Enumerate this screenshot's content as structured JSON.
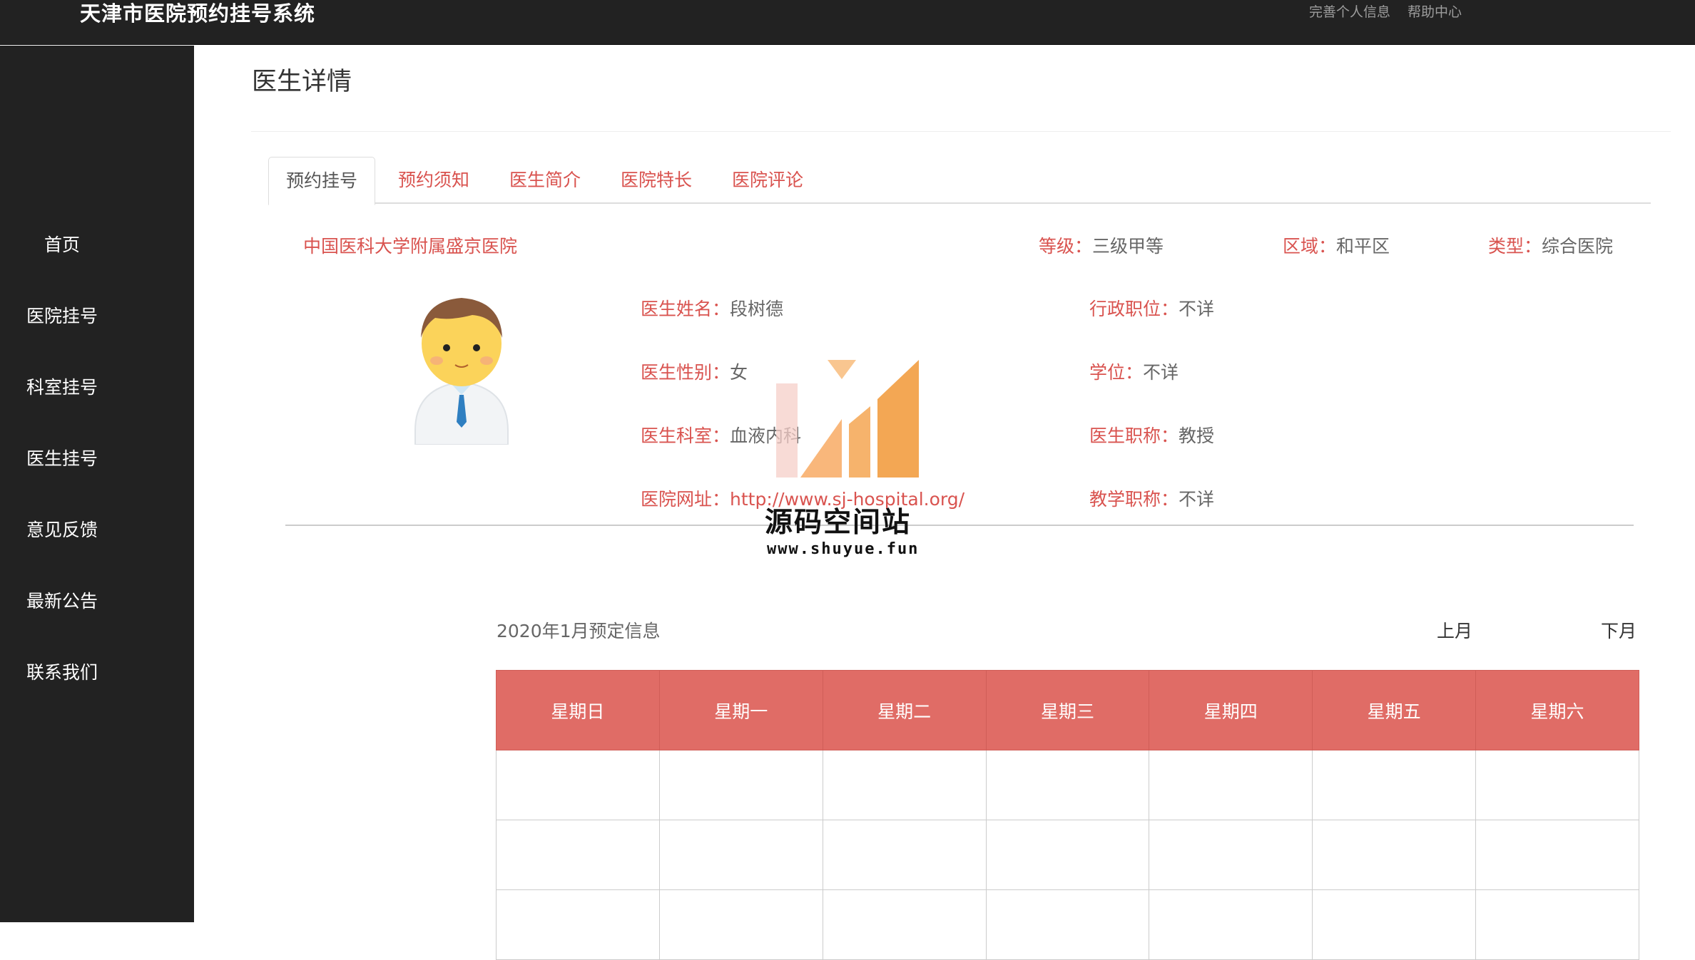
{
  "header": {
    "title": "天津市医院预约挂号系统",
    "links": [
      "完善个人信息",
      "帮助中心"
    ]
  },
  "sidebar": {
    "items": [
      "首页",
      "医院挂号",
      "科室挂号",
      "医生挂号",
      "意见反馈",
      "最新公告",
      "联系我们"
    ]
  },
  "main": {
    "title": "医生详情",
    "tabs": [
      "预约挂号",
      "预约须知",
      "医生简介",
      "医院特长",
      "医院评论"
    ],
    "active_tab": "预约挂号"
  },
  "hospital": {
    "name": "中国医科大学附属盛京医院",
    "level_label": "等级：",
    "level": "三级甲等",
    "region_label": "区域：",
    "region": "和平区",
    "type_label": "类型：",
    "type": "综合医院"
  },
  "doctor": {
    "name_label": "医生姓名：",
    "name": "段树德",
    "gender_label": "医生性别：",
    "gender": "女",
    "dept_label": "医生科室：",
    "dept": "血液内科",
    "url_label": "医院网址：",
    "url": "http://www.sj-hospital.org/",
    "admin_label": "行政职位：",
    "admin": "不详",
    "degree_label": "学位：",
    "degree": "不详",
    "title_label": "医生职称：",
    "title": "教授",
    "teach_label": "教学职称：",
    "teach": "不详"
  },
  "watermark": {
    "text": "源码空间站",
    "url": "www.shuyue.fun"
  },
  "calendar": {
    "title": "2020年1月预定信息",
    "prev": "上月",
    "next": "下月",
    "weekdays": [
      "星期日",
      "星期一",
      "星期二",
      "星期三",
      "星期四",
      "星期五",
      "星期六"
    ]
  },
  "colors": {
    "accent": "#d9534f",
    "header_bg": "#222222",
    "table_header": "#e06c66"
  }
}
